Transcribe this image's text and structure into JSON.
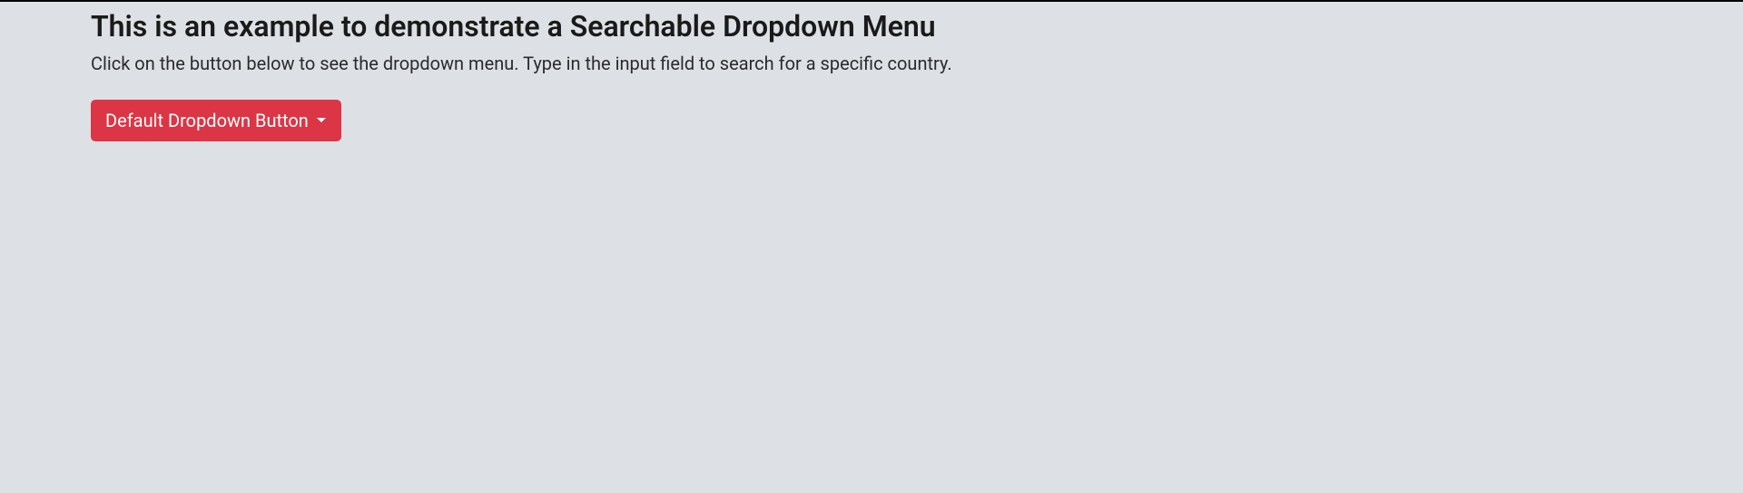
{
  "page": {
    "heading": "This is an example to demonstrate a Searchable Dropdown Menu",
    "description": "Click on the button below to see the dropdown menu. Type in the input field to search for a specific country."
  },
  "dropdown": {
    "button_label": "Default Dropdown Button",
    "button_color": "#dc3545"
  }
}
